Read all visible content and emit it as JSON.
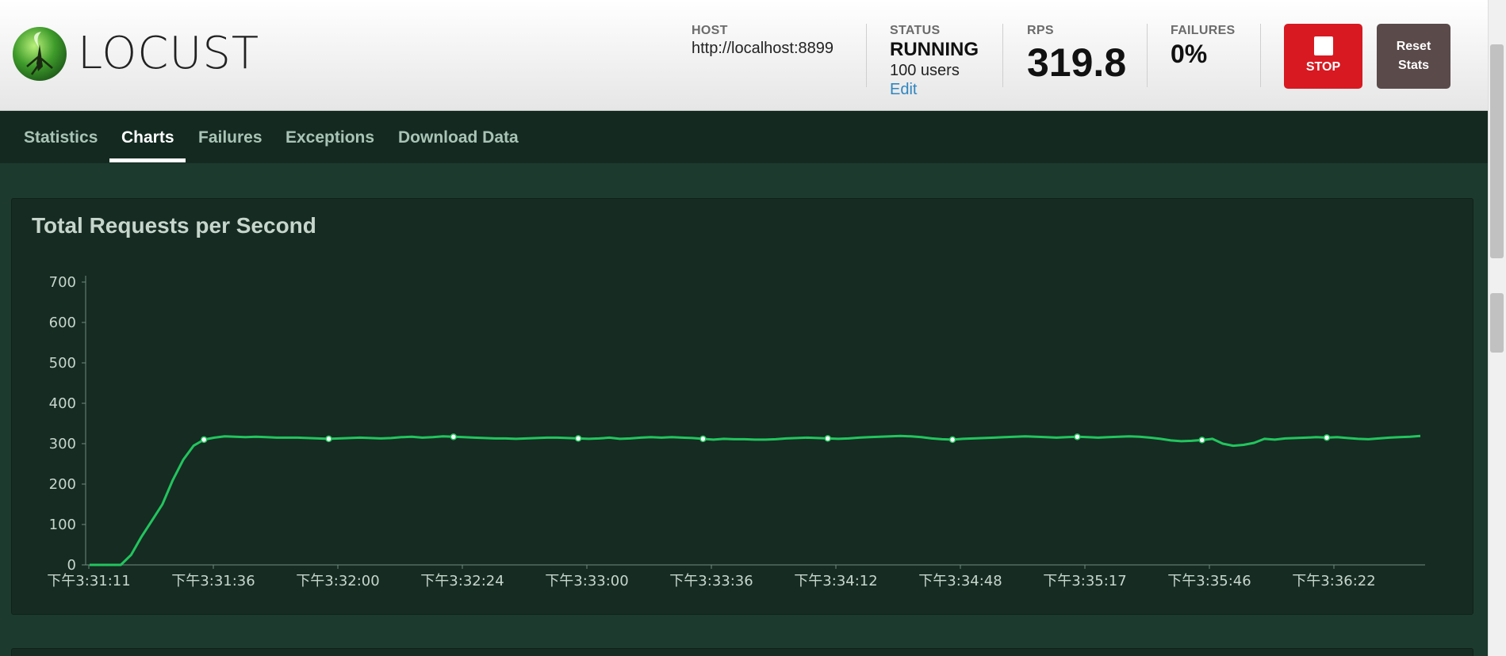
{
  "app": {
    "logo_text": "LOCUST"
  },
  "stats": {
    "host_label": "HOST",
    "host_value": "http://localhost:8899",
    "status_label": "STATUS",
    "status_value": "RUNNING",
    "users_value": "100 users",
    "edit_label": "Edit",
    "rps_label": "RPS",
    "rps_value": "319.8",
    "failures_label": "FAILURES",
    "failures_value": "0%"
  },
  "buttons": {
    "stop_label": "STOP",
    "reset_line1": "Reset",
    "reset_line2": "Stats"
  },
  "nav": {
    "tabs": [
      {
        "label": "Statistics"
      },
      {
        "label": "Charts"
      },
      {
        "label": "Failures"
      },
      {
        "label": "Exceptions"
      },
      {
        "label": "Download Data"
      }
    ],
    "active": "Charts"
  },
  "colors": {
    "line": "#22c55e",
    "accent_stop": "#d81921",
    "edit_link": "#2e86c1"
  },
  "chart_data": {
    "type": "line",
    "title": "Total Requests per Second",
    "ylim": [
      0,
      700
    ],
    "yticks": [
      0,
      100,
      200,
      300,
      400,
      500,
      600,
      700
    ],
    "xtick_labels": [
      "下午3:31:11",
      "下午3:31:36",
      "下午3:32:00",
      "下午3:32:24",
      "下午3:33:00",
      "下午3:33:36",
      "下午3:34:12",
      "下午3:34:48",
      "下午3:35:17",
      "下午3:35:46",
      "下午3:36:22"
    ],
    "series": [
      {
        "values": [
          0,
          0,
          0,
          0,
          25,
          70,
          110,
          150,
          210,
          260,
          295,
          310,
          315,
          318,
          317,
          316,
          317,
          316,
          315,
          315,
          315,
          314,
          313,
          312,
          313,
          314,
          315,
          314,
          313,
          314,
          316,
          317,
          315,
          316,
          318,
          317,
          316,
          315,
          314,
          313,
          313,
          312,
          313,
          314,
          315,
          315,
          314,
          313,
          312,
          313,
          315,
          312,
          313,
          315,
          316,
          315,
          316,
          315,
          314,
          312,
          310,
          312,
          311,
          311,
          310,
          310,
          311,
          313,
          314,
          315,
          314,
          313,
          312,
          313,
          315,
          316,
          317,
          318,
          319,
          318,
          316,
          313,
          311,
          310,
          312,
          313,
          314,
          315,
          316,
          317,
          318,
          317,
          316,
          315,
          316,
          317,
          316,
          315,
          316,
          317,
          318,
          317,
          315,
          312,
          308,
          306,
          307,
          309,
          312,
          300,
          295,
          297,
          302,
          312,
          310,
          313,
          314,
          315,
          316,
          315,
          316,
          314,
          312,
          311,
          313,
          315,
          316,
          317,
          319
        ]
      }
    ],
    "markers_every": 12,
    "grid": false
  }
}
